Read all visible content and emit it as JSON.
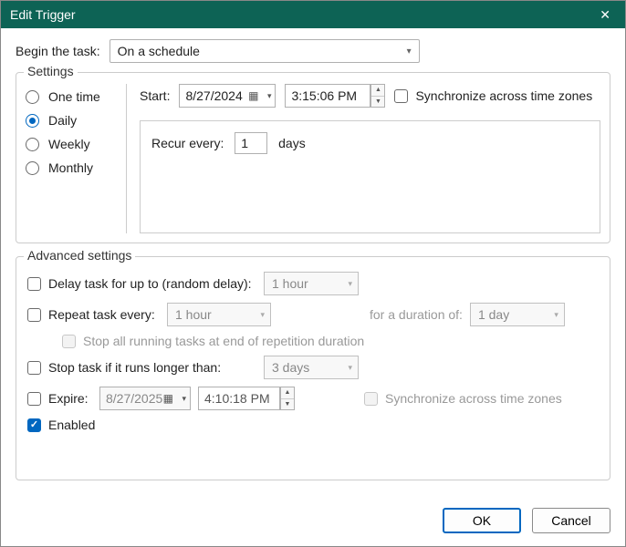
{
  "title": "Edit Trigger",
  "begin": {
    "label": "Begin the task:",
    "value": "On a schedule"
  },
  "settings": {
    "legend": "Settings",
    "radios": {
      "one_time": "One time",
      "daily": "Daily",
      "weekly": "Weekly",
      "monthly": "Monthly",
      "selected": "daily"
    },
    "start_label": "Start:",
    "start_date": "8/27/2024",
    "start_time": "3:15:06 PM",
    "sync_tz_label": "Synchronize across time zones",
    "recur_label": "Recur every:",
    "recur_value": "1",
    "recur_unit": "days"
  },
  "advanced": {
    "legend": "Advanced settings",
    "delay_label": "Delay task for up to (random delay):",
    "delay_value": "1 hour",
    "repeat_label": "Repeat task every:",
    "repeat_value": "1 hour",
    "duration_label": "for a duration of:",
    "duration_value": "1 day",
    "stop_all_label": "Stop all running tasks at end of repetition duration",
    "stop_if_label": "Stop task if it runs longer than:",
    "stop_if_value": "3 days",
    "expire_label": "Expire:",
    "expire_date": "8/27/2025",
    "expire_time": "4:10:18 PM",
    "expire_sync_label": "Synchronize across time zones",
    "enabled_label": "Enabled"
  },
  "buttons": {
    "ok": "OK",
    "cancel": "Cancel"
  }
}
